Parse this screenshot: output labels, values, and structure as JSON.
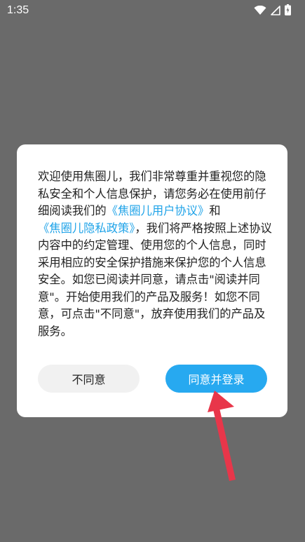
{
  "status_bar": {
    "time": "1:35",
    "icons": [
      "wifi-icon",
      "signal-icon",
      "battery-charging-icon"
    ]
  },
  "dialog": {
    "text_parts": {
      "p1": "欢迎使用焦圈儿，我们非常尊重并重视您的隐私安全和个人信息保护，请您务必在使用前仔细阅读我们的",
      "link1": "《焦圈儿用户协议》",
      "p2": "和",
      "link2": "《焦圈儿隐私政策》",
      "p3": "，我们将严格按照上述协议内容中的约定管理、使用您的个人信息，同时采用相应的安全保护措施来保护您的个人信息安全。如您已阅读并同意，请点击\"阅读并同意\"。开始使用我们的产品及服务！如您不同意，可点击\"不同意\"，放弃使用我们的产品及服务。"
    },
    "buttons": {
      "disagree": "不同意",
      "agree": "同意并登录"
    }
  },
  "colors": {
    "overlay": "#6a6a6a",
    "link": "#1fa3e8",
    "primary_button": "#27a9f0",
    "secondary_button": "#f1f1f1",
    "annotation_arrow": "#e8364a"
  }
}
